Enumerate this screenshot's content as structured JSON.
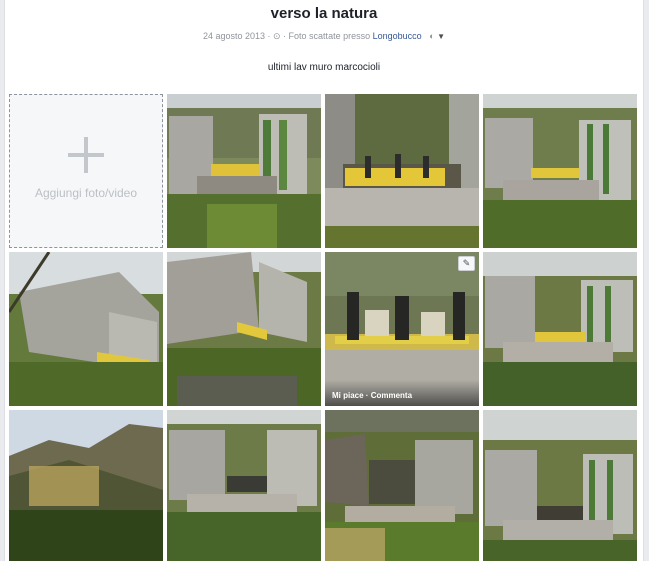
{
  "album": {
    "title": "verso la natura",
    "date": "24 agosto 2013",
    "separator": " · ",
    "location_prefix": "Foto scattate presso",
    "location": "Longobucco",
    "description": "ultimi lav muro marcocioli"
  },
  "add_tile": {
    "label": "Aggiungi foto/video"
  },
  "hover_photo": {
    "like": "Mi piace",
    "dot": " · ",
    "comment": "Commenta"
  },
  "icons": {
    "clock": "clock-icon",
    "privacy": "globe-icon",
    "edit": "pencil-icon",
    "add": "plus-icon"
  },
  "colors": {
    "link": "#365899",
    "meta": "#90949c",
    "background": "#e9ebee",
    "card": "#ffffff"
  }
}
